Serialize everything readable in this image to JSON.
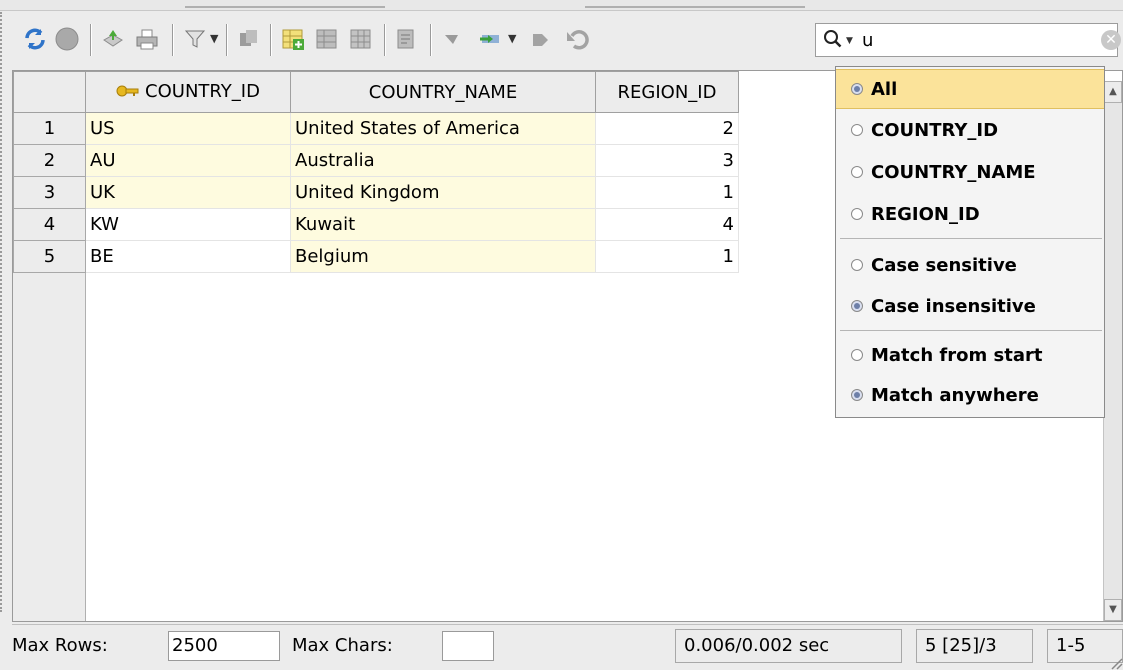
{
  "toolbar": {
    "icons": [
      "refresh-icon",
      "stop-icon",
      "save-icon",
      "print-icon",
      "filter-icon",
      "copy-icon",
      "add-row-icon",
      "delete-row-icon",
      "grid-icon",
      "edit-icon",
      "commit-icon",
      "post-icon",
      "undo-icon"
    ]
  },
  "search": {
    "value": "u"
  },
  "grid": {
    "columns": [
      "COUNTRY_ID",
      "COUNTRY_NAME",
      "REGION_ID"
    ],
    "rows": [
      {
        "num": "1",
        "id": "US",
        "name": "United States of America",
        "region": "2"
      },
      {
        "num": "2",
        "id": "AU",
        "name": "Australia",
        "region": "3"
      },
      {
        "num": "3",
        "id": "UK",
        "name": "United Kingdom",
        "region": "1"
      },
      {
        "num": "4",
        "id": "KW",
        "name": "Kuwait",
        "region": "4"
      },
      {
        "num": "5",
        "id": "BE",
        "name": "Belgium",
        "region": "1"
      }
    ]
  },
  "popup": {
    "columns": [
      {
        "label": "All",
        "selected": true
      },
      {
        "label": "COUNTRY_ID",
        "selected": false
      },
      {
        "label": "COUNTRY_NAME",
        "selected": false
      },
      {
        "label": "REGION_ID",
        "selected": false
      }
    ],
    "case_sensitive": "Case sensitive",
    "case_insensitive": "Case insensitive",
    "match_from_start": "Match from start",
    "match_anywhere": "Match anywhere"
  },
  "status": {
    "max_rows_label": "Max Rows:",
    "max_rows_value": "2500",
    "max_chars_label": "Max Chars:",
    "max_chars_value": "",
    "timing": "0.006/0.002 sec",
    "count": "5 [25]/3",
    "range": "1-5"
  },
  "colors": {
    "highlight_cell": "#fefbdf",
    "selected_item": "#fbe39a"
  }
}
